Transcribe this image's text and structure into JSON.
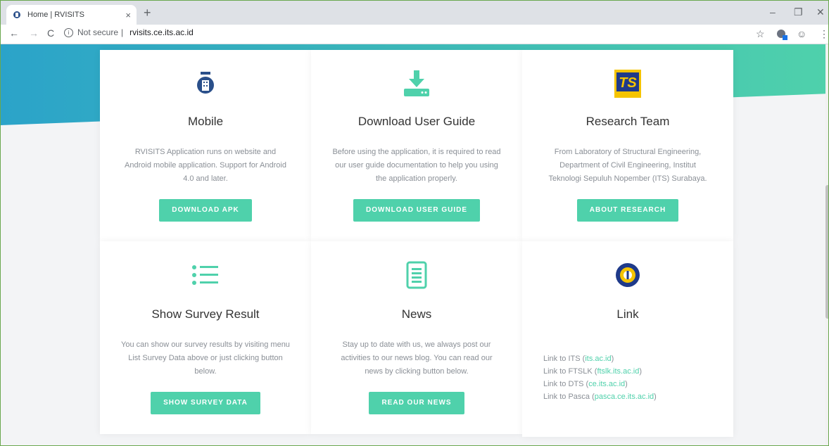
{
  "browser": {
    "tab_title": "Home | RVISITS",
    "tab_close": "×",
    "new_tab": "+",
    "security_label": "Not secure",
    "separator": "|",
    "url": "rvisits.ce.its.ac.id"
  },
  "cards": [
    {
      "title": "Mobile",
      "text": "RVISITS Application runs on website and Android mobile application. Support for Android 4.0 and later.",
      "button": "DOWNLOAD APK"
    },
    {
      "title": "Download User Guide",
      "text": "Before using the application, it is required to read our user guide documentation to help you using the application properly.",
      "button": "DOWNLOAD USER GUIDE"
    },
    {
      "title": "Research Team",
      "text": "From Laboratory of Structural Engineering, Department of Civil Engineering, Institut Teknologi Sepuluh Nopember (ITS) Surabaya.",
      "button": "ABOUT RESEARCH"
    },
    {
      "title": "Show Survey Result",
      "text": "You can show our survey results by visiting menu List Survey Data above or just clicking button below.",
      "button": "SHOW SURVEY DATA"
    },
    {
      "title": "News",
      "text": "Stay up to date with us, we always post our activities to our news blog. You can read our news by clicking button below.",
      "button": "READ OUR NEWS"
    },
    {
      "title": "Link"
    }
  ],
  "links": [
    {
      "prefix": "Link to ITS ",
      "open": "(",
      "url": "its.ac.id",
      "close": ")"
    },
    {
      "prefix": "Link to FTSLK ",
      "open": "(",
      "url": "ftslk.its.ac.id",
      "close": ")"
    },
    {
      "prefix": "Link to DTS ",
      "open": "(",
      "url": "ce.its.ac.id",
      "close": ")"
    },
    {
      "prefix": "Link to Pasca ",
      "open": "(",
      "url": "pasca.ce.its.ac.id",
      "close": ")"
    }
  ],
  "colors": {
    "accent": "#4fd1ab",
    "hero_start": "#2ba3c9",
    "hero_end": "#4fd1ab"
  }
}
